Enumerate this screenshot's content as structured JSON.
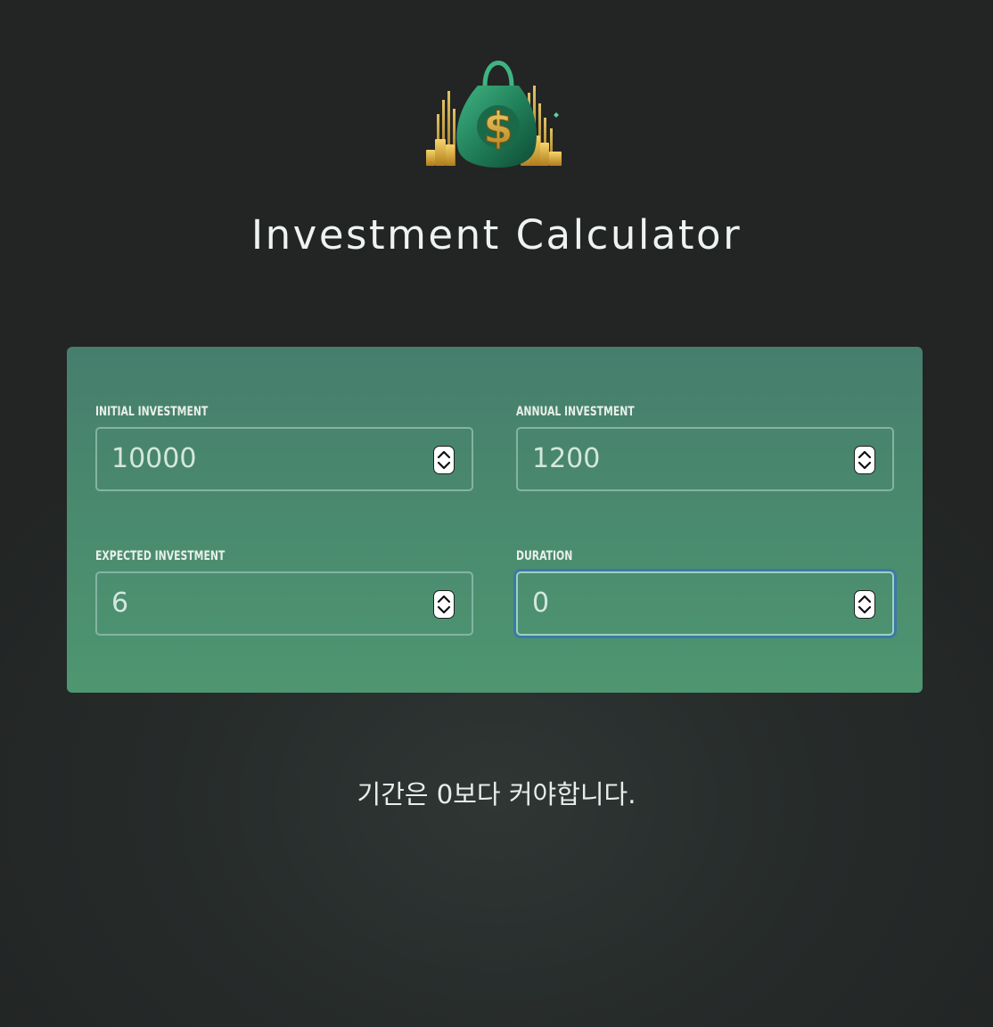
{
  "header": {
    "logo_icon": "money-bag-icon",
    "title": "Investment Calculator"
  },
  "form": {
    "initial_investment": {
      "label": "INITIAL INVESTMENT",
      "value": "10000"
    },
    "annual_investment": {
      "label": "ANNUAL INVESTMENT",
      "value": "1200"
    },
    "expected_return": {
      "label": "EXPECTED INVESTMENT",
      "value": "6"
    },
    "duration": {
      "label": "DURATION",
      "value": "0",
      "focused": true
    }
  },
  "message": {
    "text": "기간은 0보다 커야합니다."
  },
  "colors": {
    "background": "#262b2a",
    "panel_top": "#467e6d",
    "panel_bottom": "#4e9670",
    "input_border": "#84b4a2",
    "focus_ring": "#3b79a6",
    "text": "#e2ece6"
  }
}
